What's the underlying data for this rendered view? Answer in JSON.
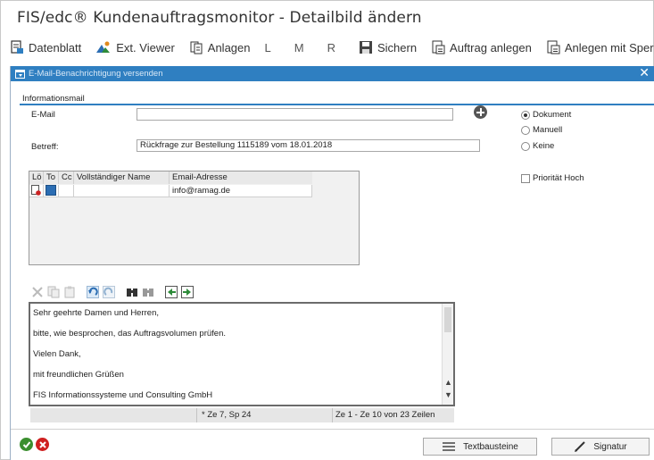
{
  "window": {
    "title": "FIS/edc® Kundenauftragsmonitor - Detailbild ändern"
  },
  "toolbar": {
    "items": [
      {
        "label": "Datenblatt",
        "icon": "datasheet-icon"
      },
      {
        "label": "Ext. Viewer",
        "icon": "ext-viewer-icon"
      },
      {
        "label": "Anlagen",
        "icon": "attachments-icon"
      },
      {
        "label": "L"
      },
      {
        "label": "M"
      },
      {
        "label": "R"
      },
      {
        "label": "Sichern",
        "icon": "save-icon"
      },
      {
        "label": "Auftrag anlegen",
        "icon": "create-order-icon"
      },
      {
        "label": "Anlegen mit Sperre",
        "icon": "create-locked-icon"
      }
    ]
  },
  "dialog": {
    "title": "E-Mail-Benachrichtigung versenden",
    "close_glyph": "✕",
    "group_label": "Informationsmail",
    "email_label": "E-Mail",
    "email_value": "",
    "subject_label": "Betreff:",
    "subject_value": "Rückfrage zur Bestellung 1115189 vom 18.01.2018",
    "options": {
      "selected": "Dokument",
      "items": [
        "Dokument",
        "Manuell",
        "Keine"
      ]
    },
    "priority_label": "Priorität Hoch",
    "priority_checked": false,
    "recipients": {
      "columns": [
        "Lö",
        "To",
        "Cc",
        "Vollständiger Name",
        "Email-Adresse"
      ],
      "rows": [
        {
          "name": "",
          "email": "info@ramag.de",
          "to": true,
          "cc": false
        }
      ]
    },
    "editor": {
      "lines": [
        "Sehr geehrte Damen und Herren,",
        "bitte, wie besprochen, das Auftragsvolumen prüfen.",
        "Vielen Dank,",
        "mit freundlichen Grüßen",
        "FIS Informationssysteme und Consulting GmbH"
      ]
    },
    "status": {
      "cursor": "* Ze 7, Sp 24",
      "range": "Ze 1 - Ze 10 von 23 Zeilen"
    },
    "buttons": {
      "textbausteine": "Textbausteine",
      "signatur": "Signatur"
    }
  },
  "colors": {
    "dialog_title_bar": "#2f7fc1",
    "confirm": "#3b8f2f",
    "cancel": "#cf2020"
  }
}
